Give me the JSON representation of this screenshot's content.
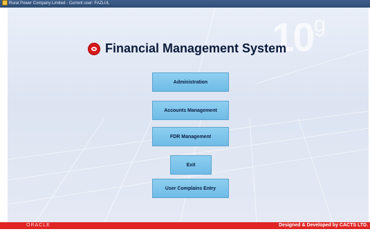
{
  "window": {
    "title": "Rural Power Company Limited - Current user: FAZLUL"
  },
  "watermark": {
    "number": "10",
    "suffix": "g"
  },
  "main": {
    "title": "Financial Management System"
  },
  "menu": {
    "administration": "Administration",
    "accounts": "Accounts Management",
    "fdr": "FDR Management",
    "exit": "Exit",
    "complains": "User Complains Entry"
  },
  "footer": {
    "brand": "ORACLE",
    "credit": "Designed & Developed by CACTS LTD."
  },
  "colors": {
    "accent_button": "#7cc4ec",
    "footer_bar": "#e02424",
    "title_bar": "#2e4c74",
    "logo": "#d81b1b"
  }
}
